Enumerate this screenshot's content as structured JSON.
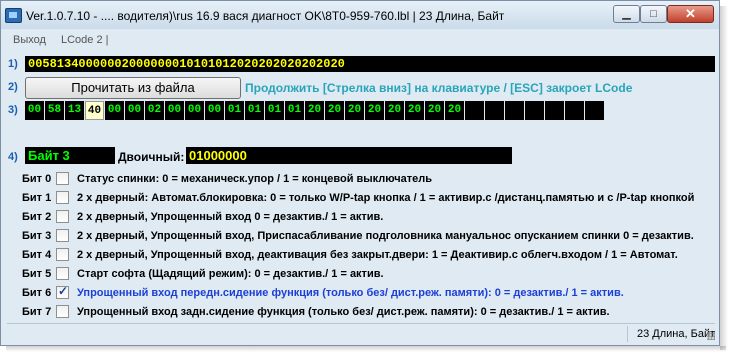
{
  "window": {
    "title": "Ver.1.0.7.10 - .... водителя)\\rus 16.9 вася диагност OK\\8T0-959-760.lbl | 23 Длина, Байт"
  },
  "menu": {
    "exit": "Выход",
    "lcode": "LCode 2 |"
  },
  "rows": {
    "r1": "1)",
    "r2": "2)",
    "r3": "3)",
    "r4": "4)"
  },
  "hex_string": "00581340000002000000010101012020202020202020",
  "read_button": "Прочитать из файла",
  "hint": "Продолжить [Стрелка вниз] на клавиатуре / [ESC] закроет LCode",
  "bytes": [
    "00",
    "58",
    "13",
    "40",
    "00",
    "00",
    "02",
    "00",
    "00",
    "00",
    "01",
    "01",
    "01",
    "01",
    "20",
    "20",
    "20",
    "20",
    "20",
    "20",
    "20",
    "20",
    "",
    "",
    "",
    "",
    "",
    "",
    ""
  ],
  "selected_byte_index": 3,
  "byte_label": "Байт 3",
  "binary_label": "Двоичный:",
  "binary_value": "01000000",
  "bits": [
    {
      "label": "Бит 0",
      "checked": false,
      "desc": "Статус спинки: 0 = механическ.упор / 1 = концевой выключатель"
    },
    {
      "label": "Бит 1",
      "checked": false,
      "desc": "2 х дверный: Автомат.блокировка: 0 = только W/P-tap кнопка / 1 = активир.с /дистанц.памятью и с /P-tap кнопкой"
    },
    {
      "label": "Бит 2",
      "checked": false,
      "desc": "2 х дверный, Упрощенный вход 0 = дезактив./ 1 = актив."
    },
    {
      "label": "Бит 3",
      "checked": false,
      "desc": "2 х дверный, Упрощенный вход, Приспасабливание подголовника мануальнос опусканием спинки 0 = дезактив."
    },
    {
      "label": "Бит 4",
      "checked": false,
      "desc": "2 х дверный, Упрощенный вход, деактивация без закрыт.двери: 1 = Деактивир.с облегч.входом / 1 = Автомат."
    },
    {
      "label": "Бит 5",
      "checked": false,
      "desc": "Старт софта (Щадящий режим): 0 = дезактив./ 1 = актив."
    },
    {
      "label": "Бит 6",
      "checked": true,
      "desc": "Упрощенный вход передн.сидение функция (только без/ дист.реж. памяти): 0 = дезактив./ 1 = актив."
    },
    {
      "label": "Бит 7",
      "checked": false,
      "desc": "Упрощенный вход задн.сидение функция (только без/ дист.реж. памяти): 0 = дезактив./ 1 = актив."
    }
  ],
  "status": "23 Длина, Байт",
  "colors": {
    "background": "#dfeaf3",
    "hex_text": "#ffff00",
    "byte_text": "#00ff00",
    "hint_text": "#2aa4b8",
    "checked_bit_text": "#1c3fd6"
  }
}
